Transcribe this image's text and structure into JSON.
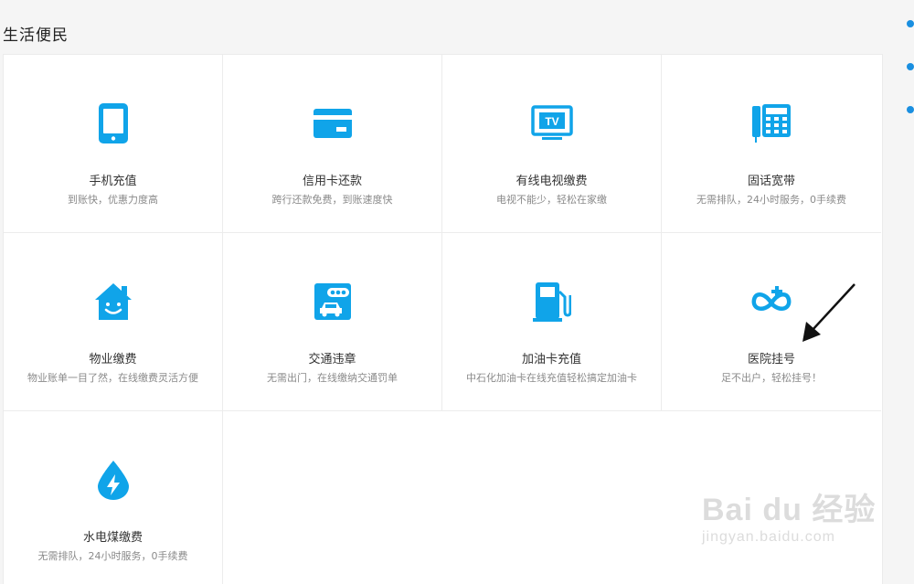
{
  "section": {
    "title": "生活便民"
  },
  "accent_color": "#10a4e9",
  "services": [
    {
      "name": "手机充值",
      "desc": "到账快，优惠力度高",
      "icon": "mobile-phone-icon"
    },
    {
      "name": "信用卡还款",
      "desc": "跨行还款免费，到账速度快",
      "icon": "credit-card-icon"
    },
    {
      "name": "有线电视缴费",
      "desc": "电视不能少，轻松在家缴",
      "icon": "tv-icon"
    },
    {
      "name": "固话宽带",
      "desc": "无需排队，24小时服务，0手续费",
      "icon": "landline-phone-icon"
    },
    {
      "name": "物业缴费",
      "desc": "物业账单一目了然，在线缴费灵活方便",
      "icon": "house-icon"
    },
    {
      "name": "交通违章",
      "desc": "无需出门，在线缴纳交通罚单",
      "icon": "car-ticket-icon"
    },
    {
      "name": "加油卡充值",
      "desc": "中石化加油卡在线充值轻松搞定加油卡",
      "icon": "fuel-pump-icon"
    },
    {
      "name": "医院挂号",
      "desc": "足不出户，轻松挂号！",
      "icon": "medical-cross-icon"
    },
    {
      "name": "水电煤缴费",
      "desc": "无需排队，24小时服务，0手续费",
      "icon": "water-drop-icon"
    }
  ],
  "watermark": {
    "logo": "Bai du 经验",
    "url": "jingyan.baidu.com"
  }
}
